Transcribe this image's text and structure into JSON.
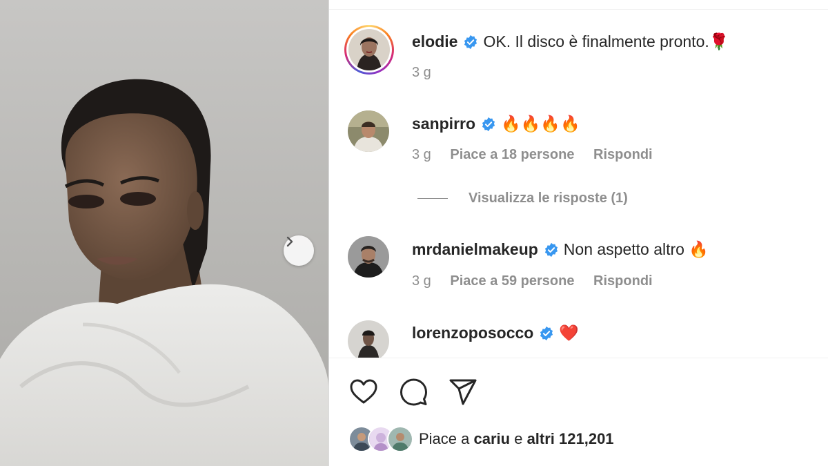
{
  "post": {
    "next_icon": "chevron-right-icon",
    "caption": {
      "username": "elodie",
      "text": "OK. Il disco è finalmente pronto.🌹",
      "time": "3 g"
    }
  },
  "comments": [
    {
      "username": "sanpirro",
      "text": "🔥🔥🔥🔥",
      "time": "3 g",
      "likes": "Piace a 18 persone",
      "reply": "Rispondi"
    },
    {
      "username": "mrdanielmakeup",
      "text": "Non aspetto altro 🔥",
      "time": "3 g",
      "likes": "Piace a 59 persone",
      "reply": "Rispondi"
    },
    {
      "username": "lorenzoposocco",
      "text": "❤️"
    }
  ],
  "view_replies": "Visualizza le risposte (1)",
  "actions": {
    "like_icon": "heart-icon",
    "comment_icon": "comment-bubble-icon",
    "share_icon": "paper-plane-icon"
  },
  "likes_summary": {
    "prefix": "Piace a ",
    "user": "cariu",
    "middle": " e ",
    "rest": "altri 121,201"
  },
  "colors": {
    "verified": "#3897f0",
    "secondary_text": "#8e8e8e",
    "primary_text": "#262626"
  }
}
